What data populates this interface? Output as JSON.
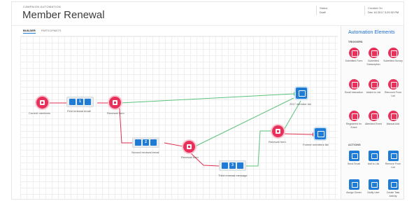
{
  "header": {
    "eyebrow": "CAMPAIGN AUTOMATION",
    "title": "Member Renewal",
    "status_label": "Status",
    "status_value": "Draft",
    "created_label": "Created On",
    "created_value": "Dec 16 2017 3:29:32 PM"
  },
  "tabs": [
    {
      "label": "BUILDER",
      "active": true
    },
    {
      "label": "PARTICIPANTS",
      "active": false
    }
  ],
  "canvas": {
    "nodes": {
      "current_members": "Current members",
      "first_renewal_email": "First renewal email",
      "first_renewal_badge": "1",
      "renewal_form_1": "Renewal form",
      "second_renewal_email": "Second renewal email",
      "second_renewal_badge": "2",
      "renewal_form_2": "Renewal form",
      "third_renewal_message": "Third renewal message",
      "third_renewal_badge": "3",
      "renewal_form_3": "Renewal form",
      "member_list_2017": "2017 member list",
      "former_members_list": "Former members list"
    },
    "colors": {
      "success": "#5cc37a",
      "failure": "#e0304f",
      "default": "#e0304f"
    }
  },
  "panel": {
    "title": "Automation Elements",
    "triggers_head": "TRIGGERS",
    "actions_head": "ACTIONS",
    "triggers": [
      {
        "label": "Submitted Form",
        "icon": "form-icon"
      },
      {
        "label": "Submitted Subscription",
        "icon": "subscription-icon"
      },
      {
        "label": "Submitted Survey",
        "icon": "survey-icon"
      },
      {
        "label": "Email Interaction",
        "icon": "email-icon"
      },
      {
        "label": "Added to List",
        "icon": "list-add-icon"
      },
      {
        "label": "Removed From List",
        "icon": "list-remove-icon"
      },
      {
        "label": "Registered for Event",
        "icon": "event-icon"
      },
      {
        "label": "Attended Event",
        "icon": "attended-icon"
      },
      {
        "label": "Manual Add",
        "icon": "manual-add-icon"
      }
    ],
    "actions": [
      {
        "label": "Send Email",
        "icon": "send-email-icon"
      },
      {
        "label": "Add to List",
        "icon": "add-list-icon"
      },
      {
        "label": "Remove From List",
        "icon": "remove-list-icon"
      },
      {
        "label": "Assign Owner",
        "icon": "assign-owner-icon"
      },
      {
        "label": "Notify User",
        "icon": "notify-user-icon"
      },
      {
        "label": "Create Task Activity",
        "icon": "create-task-icon"
      }
    ],
    "accent": "#1e6fd0",
    "trigger_color": "#e8305a",
    "action_color": "#1e7bd6"
  }
}
